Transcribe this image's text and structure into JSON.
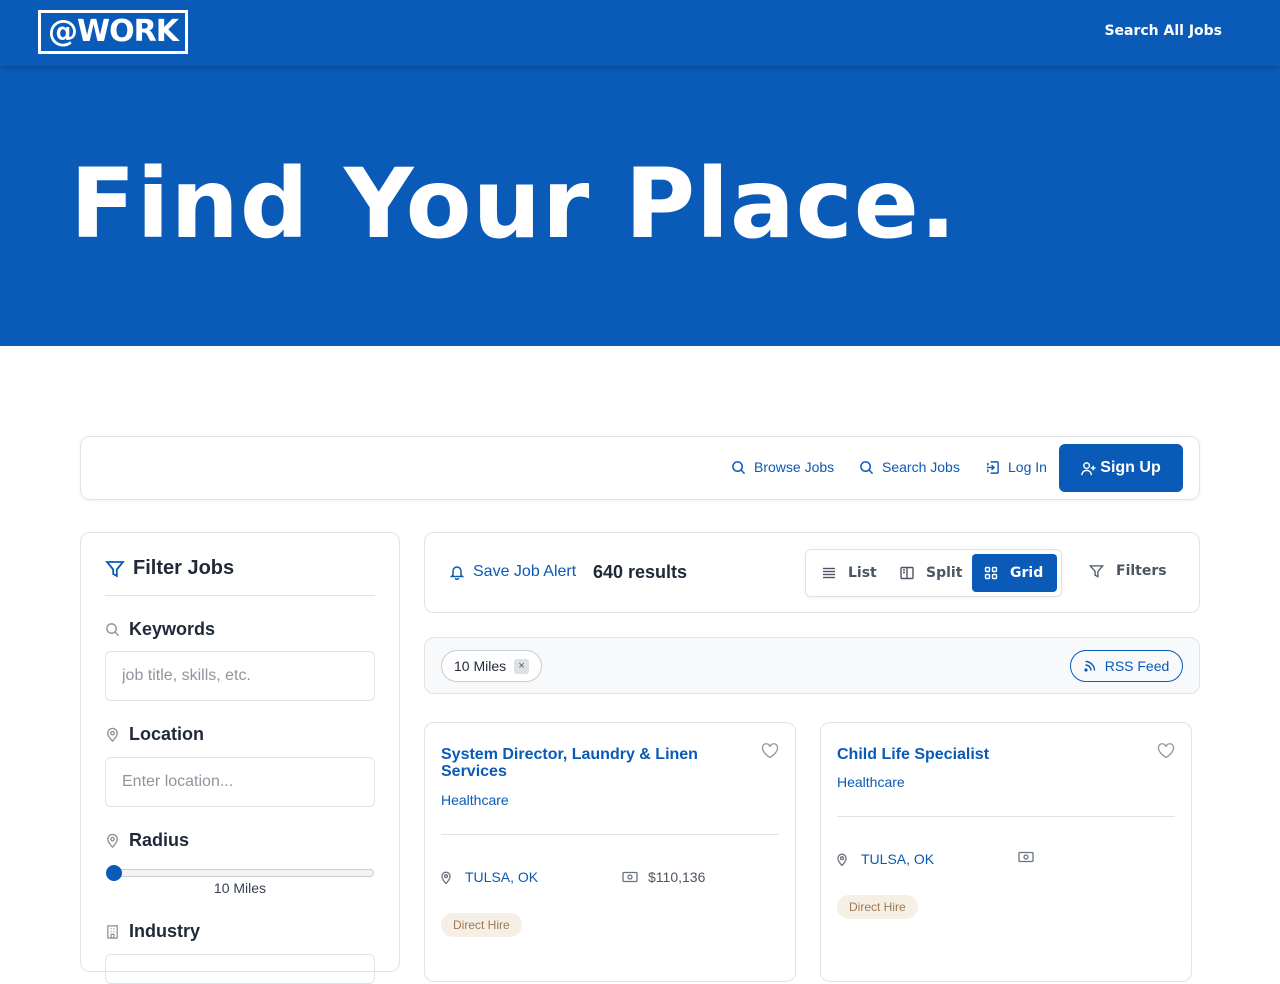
{
  "header": {
    "logo_text": "@WORK",
    "search_all_label": "Search All Jobs"
  },
  "hero": {
    "title": "Find Your Place."
  },
  "nav": {
    "browse_label": "Browse Jobs",
    "search_label": "Search Jobs",
    "login_label": "Log In",
    "signup_label": "Sign Up"
  },
  "filter": {
    "title": "Filter Jobs",
    "keywords_label": "Keywords",
    "keywords_placeholder": "job title, skills, etc.",
    "location_label": "Location",
    "location_placeholder": "Enter location...",
    "radius_label": "Radius",
    "radius_value_text": "10 Miles",
    "radius_fraction": 0,
    "industry_label": "Industry"
  },
  "results": {
    "save_alert_label": "Save Job Alert",
    "count_text": "640 results",
    "views": {
      "list": "List",
      "split": "Split",
      "grid": "Grid",
      "active": "grid"
    },
    "filters_label": "Filters",
    "chips": [
      {
        "label": "10 Miles",
        "remove": "×"
      }
    ],
    "rss_label": "RSS Feed"
  },
  "jobs": [
    {
      "title": "System Director, Laundry & Linen Services",
      "category": "Healthcare",
      "location": "TULSA, OK",
      "salary": "$110,136",
      "type": "Direct Hire"
    },
    {
      "title": "Child Life Specialist",
      "category": "Healthcare",
      "location": "TULSA, OK",
      "salary": "",
      "type": "Direct Hire"
    }
  ],
  "colors": {
    "brand": "#0a5ab7",
    "border": "#dfe3e8",
    "tag_bg": "#f5efe6",
    "tag_text": "#a07850"
  }
}
